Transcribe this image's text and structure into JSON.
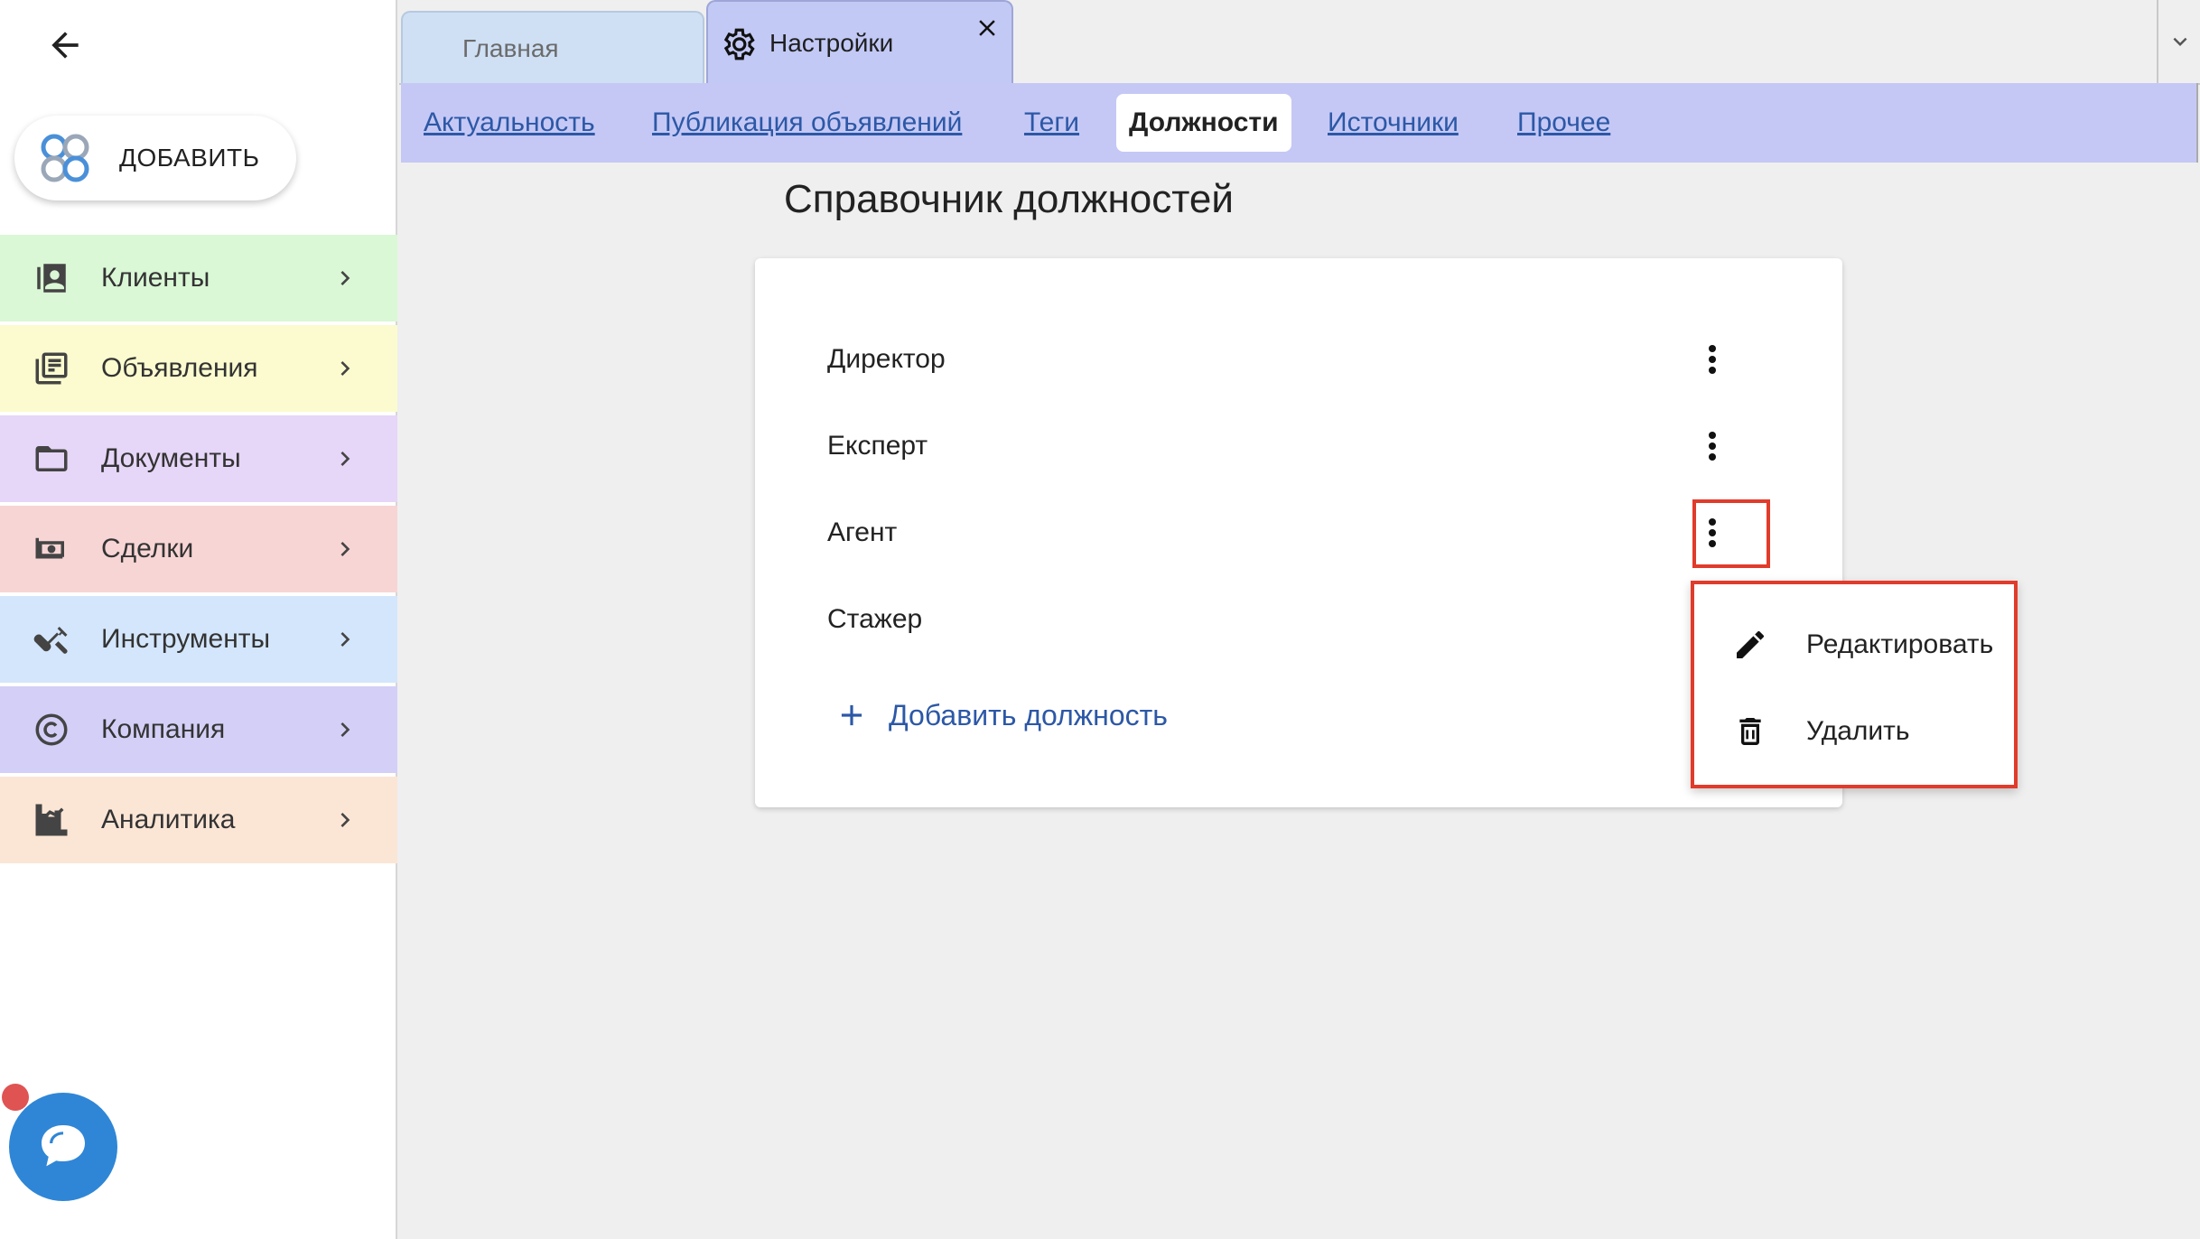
{
  "sidebar": {
    "add_label": "ДОБАВИТЬ",
    "items": [
      {
        "label": "Клиенты",
        "icon": "contacts-icon",
        "color": "#daf7d6"
      },
      {
        "label": "Объявления",
        "icon": "listings-icon",
        "color": "#fbfbcf"
      },
      {
        "label": "Документы",
        "icon": "folder-icon",
        "color": "#e6d6f8"
      },
      {
        "label": "Сделки",
        "icon": "money-icon",
        "color": "#f8d5d5"
      },
      {
        "label": "Инструменты",
        "icon": "tools-icon",
        "color": "#d4e6fb"
      },
      {
        "label": "Компания",
        "icon": "copyright-icon",
        "color": "#d3cff7"
      },
      {
        "label": "Аналитика",
        "icon": "analytics-icon",
        "color": "#fbe6d6"
      }
    ]
  },
  "tabs": {
    "home": "Главная",
    "settings": "Настройки"
  },
  "subnav": {
    "items": [
      "Актуальность",
      "Публикация объявлений",
      "Теги",
      "Должности",
      "Источники",
      "Прочее"
    ],
    "active": "Должности"
  },
  "main": {
    "title": "Справочник должностей",
    "positions": [
      "Директор",
      "Експерт",
      "Агент",
      "Стажер"
    ],
    "add_label": "Добавить должность"
  },
  "context_menu": {
    "edit": "Редактировать",
    "delete": "Удалить"
  },
  "colors": {
    "accent_link": "#2c58a6",
    "highlight": "#e13b2b",
    "subnav_bg": "#c5c8f5"
  }
}
